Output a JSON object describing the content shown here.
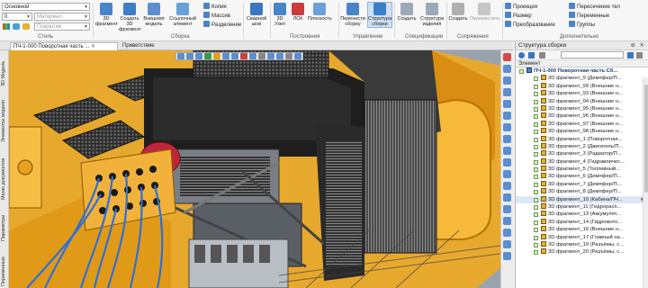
{
  "ribbon": {
    "style_combo": "Основной",
    "line_weight": "0",
    "material_placeholder": "Материал",
    "coating_placeholder": "Покрытие",
    "style_group": "Стиль",
    "btn_fragment": "3D фрагмент",
    "btn_create_fragment": "Создать 3D фрагмент",
    "btn_ext_model": "Внешняя модель",
    "btn_ref_element": "Ссылочный элемент",
    "btn_copy": "Копия",
    "btn_array": "Массив",
    "btn_split": "Разделение",
    "group_assembly": "Сборка",
    "btn_weld": "Сварной шов",
    "btn_3d_node": "3D Узел",
    "btn_lcs": "ЛСК",
    "btn_plane": "Плоскость",
    "group_build": "Построения",
    "btn_move_asm": "Перенести сборку",
    "btn_asm_struct": "Структура сборки",
    "group_control": "Управление",
    "btn_create": "Создать",
    "btn_product_struct": "Структура изделия",
    "group_spec": "Спецификации",
    "btn_create2": "Создать",
    "btn_move2": "Переместить",
    "group_mates": "Сопряжения",
    "btn_projection": "Проекция",
    "btn_size": "Размер",
    "btn_transform": "Преобразование",
    "btn_body_intersect": "Пересечение тел",
    "btn_variables": "Переменные",
    "btn_groups": "Группы",
    "group_additional": "Дополнительно"
  },
  "tabs": [
    "ПЧ-1-000 Поворотная часть ...",
    "Приветствие"
  ],
  "left_tabs": [
    "3D Модель",
    "Элементы модели",
    "Меню документов",
    "Параметры",
    "Переменные"
  ],
  "panel": {
    "title": "Структура сборки",
    "column": "Элемент",
    "root": "ПЧ-1-000 Поворотная часть Сб...",
    "rows": [
      "3D фрагмент_9 (Демпфер/П...",
      "3D фрагмент_99 (Внешние н...",
      "3D фрагмент_93 (Внешние н...",
      "3D фрагмент_94 (Внешние н...",
      "3D фрагмент_95 (Внешние н...",
      "3D фрагмент_96 (Внешние н...",
      "3D фрагмент_97 (Внешние н...",
      "3D фрагмент_98 (Внешние н...",
      "3D фрагмент_1 (Поворотная...",
      "3D фрагмент_2 (Двигатель/П...",
      "3D фрагмент_3 (Радиатор/П...",
      "3D фрагмент_4 (Гидравличес...",
      "3D фрагмент_5 (Топливный...",
      "3D фрагмент_6 (Демпфер/П...",
      "3D фрагмент_7 (Демпфер/П...",
      "3D фрагмент_8 (Демпфер/П...",
      "3D фрагмент_10 (Кабина/ПЧ...",
      "3D фрагмент_11 (Гидрорасп...",
      "3D фрагмент_13 (Аккумулят...",
      "3D фрагмент_14 (Гидромото...",
      "3D фрагмент_16 (Внешние н...",
      "3D фрагмент_17 (Главный на...",
      "3D фрагмент_19 (Разъёмы, с...",
      "3D фрагмент_20 (Разъёмы, с..."
    ],
    "selected_index": 16
  },
  "colors": {
    "accent": "#2b6cc4",
    "cube": "#e8b030",
    "machine_body": "#f0a820"
  }
}
